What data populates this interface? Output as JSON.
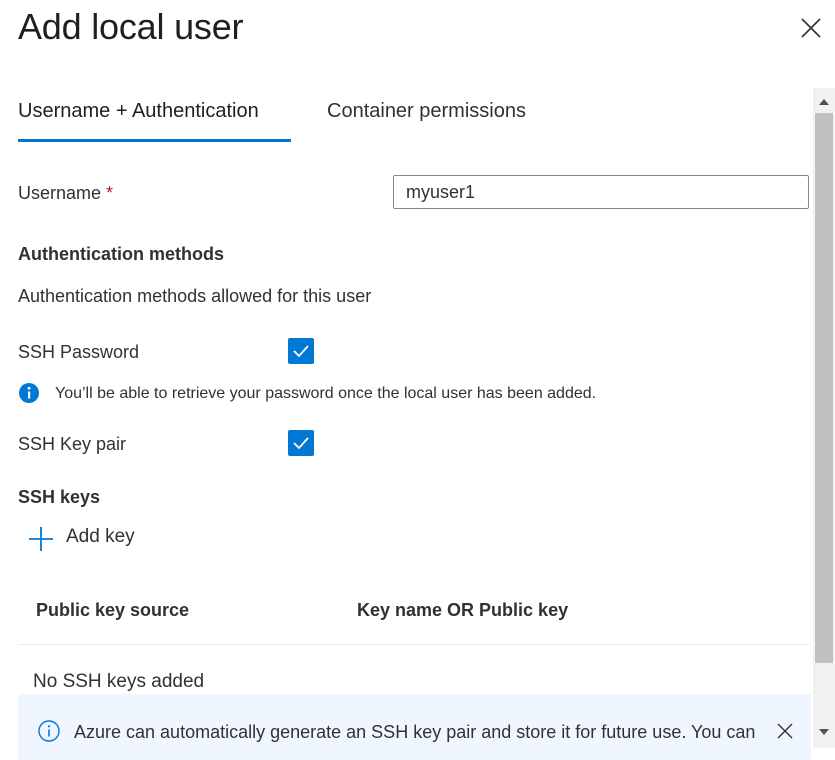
{
  "panel": {
    "title": "Add local user",
    "close_icon": "close-icon"
  },
  "tabs": [
    {
      "label": "Username + Authentication",
      "active": true
    },
    {
      "label": "Container permissions",
      "active": false
    }
  ],
  "form": {
    "username_label": "Username",
    "required_marker": "*",
    "username_value": "myuser1"
  },
  "auth": {
    "heading": "Authentication methods",
    "description": "Authentication methods allowed for this user",
    "ssh_password_label": "SSH Password",
    "ssh_password_checked": true,
    "password_info": "You’ll be able to retrieve your password once the local user has been added.",
    "ssh_keypair_label": "SSH Key pair",
    "ssh_keypair_checked": true
  },
  "ssh_keys": {
    "heading": "SSH keys",
    "add_label": "Add key",
    "columns": [
      "Public key source",
      "Key name OR Public key"
    ],
    "empty_message": "No SSH keys added"
  },
  "info_bar": {
    "text": "Azure can automatically generate an SSH key pair and store it for future use. You can",
    "icon": "info-icon"
  },
  "colors": {
    "accent": "#0078d4",
    "required": "#a4262c",
    "info_bar_bg": "#f0f6ff"
  }
}
